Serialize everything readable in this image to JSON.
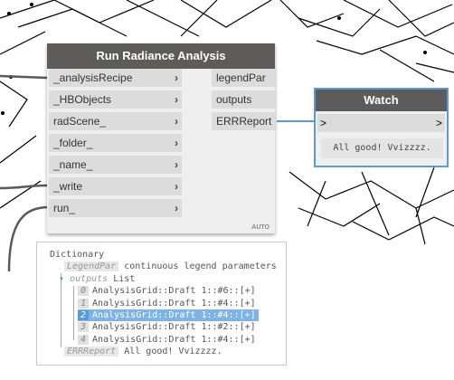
{
  "analysis_node": {
    "title": "Run Radiance Analysis",
    "inputs": [
      "_analysisRecipe",
      "_HBObjects",
      "radScene_",
      "_folder_",
      "_name_",
      "_write",
      "run_"
    ],
    "input_arrow": "›",
    "outputs": [
      "legendPar",
      "outputs",
      "ERRReport"
    ],
    "badge": "AUTO"
  },
  "watch_node": {
    "title": "Watch",
    "in_arrow": ">",
    "out_arrow": ">",
    "value": "All good! Vvizzzz."
  },
  "preview": {
    "root": "Dictionary",
    "legend_key": "LegendPar",
    "legend_value": "continuous legend parameters",
    "outputs_key": "outputs",
    "outputs_type": "List",
    "outputs_toggle": "▾",
    "items": [
      {
        "index": "0",
        "text": "AnalysisGrid::Draft 1::#6::[+]"
      },
      {
        "index": "1",
        "text": "AnalysisGrid::Draft 1::#4::[+]"
      },
      {
        "index": "2",
        "text": "AnalysisGrid::Draft 1::#4::[+]"
      },
      {
        "index": "3",
        "text": "AnalysisGrid::Draft 1::#2::[+]"
      },
      {
        "index": "4",
        "text": "AnalysisGrid::Draft 1::#4::[+]"
      }
    ],
    "selected_index": 2,
    "err_key": "ERRReport",
    "err_value": "All good! Vvizzzz."
  }
}
